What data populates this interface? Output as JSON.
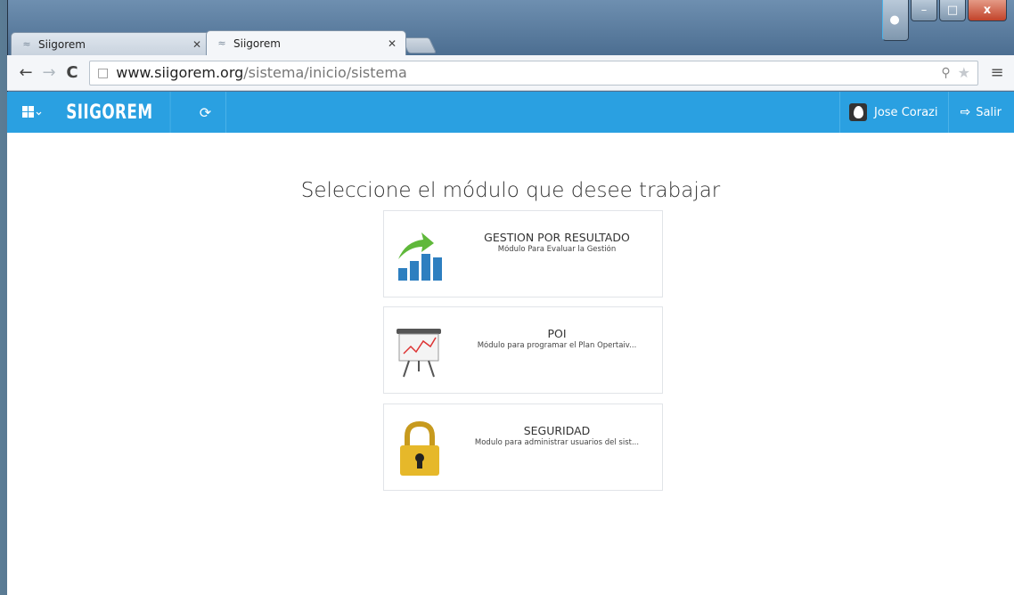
{
  "browser": {
    "tabs": [
      {
        "title": "Siigorem",
        "active": false
      },
      {
        "title": "Siigorem",
        "active": true
      }
    ],
    "url_host": "www.siigorem.org",
    "url_path": "/sistema/inicio/sistema"
  },
  "appbar": {
    "brand": "SIIGOREM",
    "user_name": "Jose Corazi",
    "logout_label": "Salir",
    "color": "#2aa0e1"
  },
  "main": {
    "heading": "Seleccione el módulo que desee trabajar",
    "modules": [
      {
        "title": "GESTION POR RESULTADO",
        "description": "Módulo Para Evaluar la Gestión",
        "icon": "growth-chart-icon"
      },
      {
        "title": "POI",
        "description": "Módulo para programar el Plan Opertaiv...",
        "icon": "presentation-board-icon"
      },
      {
        "title": "SEGURIDAD",
        "description": "Modulo para administrar usuarios del sist...",
        "icon": "padlock-icon"
      }
    ]
  }
}
